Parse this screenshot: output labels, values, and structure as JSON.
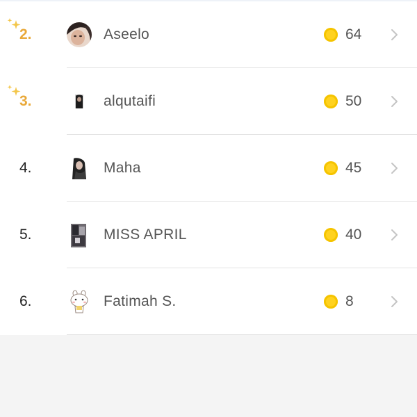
{
  "leaderboard": {
    "rows": [
      {
        "rank": "2.",
        "name": "Aseelo",
        "score": "64",
        "highlight": true,
        "avatar": "avatar-selfie"
      },
      {
        "rank": "3.",
        "name": "alqutaifi",
        "score": "50",
        "highlight": true,
        "avatar": "avatar-dark"
      },
      {
        "rank": "4.",
        "name": "Maha",
        "score": "45",
        "highlight": false,
        "avatar": "avatar-girl"
      },
      {
        "rank": "5.",
        "name": "MISS APRIL",
        "score": "40",
        "highlight": false,
        "avatar": "avatar-collage"
      },
      {
        "rank": "6.",
        "name": "Fatimah S.",
        "score": "8",
        "highlight": false,
        "avatar": "avatar-bear"
      }
    ]
  },
  "icons": {
    "sparkle": "sparkles-icon",
    "coin": "coin-icon",
    "chevron": "chevron-right-icon"
  },
  "colors": {
    "highlight_rank": "#e9a93a",
    "coin": "#ffd21f",
    "divider": "#e3e3e3",
    "background": "#f4f4f4"
  }
}
